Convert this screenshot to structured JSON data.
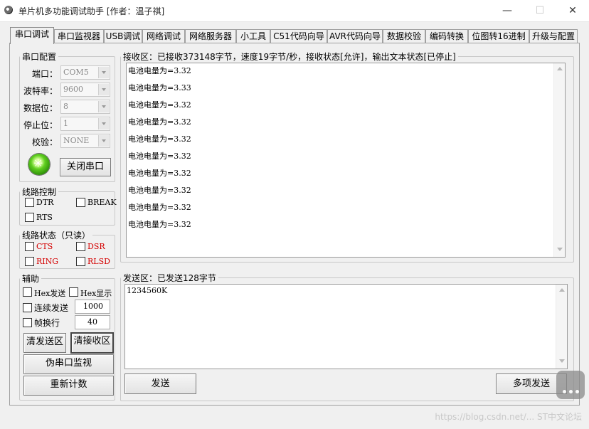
{
  "window": {
    "title": "单片机多功能调试助手 [作者：温子祺]",
    "controls": {
      "minimize": "—",
      "maximize": "☐",
      "close": "✕"
    }
  },
  "tabs": [
    {
      "label": "串口调试",
      "active": true
    },
    {
      "label": "串口监视器"
    },
    {
      "label": "USB调试"
    },
    {
      "label": "网络调试"
    },
    {
      "label": "网络服务器"
    },
    {
      "label": "小工具"
    },
    {
      "label": "C51代码向导"
    },
    {
      "label": "AVR代码向导"
    },
    {
      "label": "数据校验"
    },
    {
      "label": "编码转换"
    },
    {
      "label": "位图转16进制"
    },
    {
      "label": "升级与配置"
    }
  ],
  "serial_config": {
    "legend": "串口配置",
    "port_label": "端口：",
    "port_value": "COM5",
    "baud_label": "波特率：",
    "baud_value": "9600",
    "databits_label": "数据位：",
    "databits_value": "8",
    "stopbits_label": "停止位：",
    "stopbits_value": "1",
    "parity_label": "校验：",
    "parity_value": "NONE",
    "close_button": "关闭串口",
    "status_icon": "port-open-green-icon"
  },
  "line_control": {
    "legend": "线路控制",
    "dtr": "DTR",
    "break": "BREAK",
    "rts": "RTS"
  },
  "line_status": {
    "legend": "线路状态（只读）",
    "cts": "CTS",
    "dsr": "DSR",
    "ring": "RING",
    "rlsd": "RLSD",
    "color": "#d40000"
  },
  "aux": {
    "legend": "辅助",
    "hex_send": "Hex发送",
    "hex_display": "Hex显示",
    "continuous_send": "连续发送",
    "continuous_value": "1000",
    "frame_newline": "帧换行",
    "frame_value": "40",
    "clear_send": "清发送区",
    "clear_recv": "清接收区",
    "pseudo_monitor": "伪串口监视",
    "recount": "重新计数"
  },
  "receive": {
    "legend": "接收区：已接收373148字节，速度19字节/秒，接收状态[允许]，输出文本状态[已停止]",
    "lines": [
      "电池电量为=3.32",
      "电池电量为=3.33",
      "电池电量为=3.32",
      "电池电量为=3.32",
      "电池电量为=3.32",
      "电池电量为=3.32",
      "电池电量为=3.32",
      "电池电量为=3.32",
      "电池电量为=3.32",
      "电池电量为=3.32"
    ]
  },
  "send": {
    "legend": "发送区：已发送128字节",
    "content": "1234560K",
    "send_button": "发送",
    "multi_send_button": "多项发送"
  },
  "watermark": "https://blog.csdn.net/... ST中文论坛"
}
